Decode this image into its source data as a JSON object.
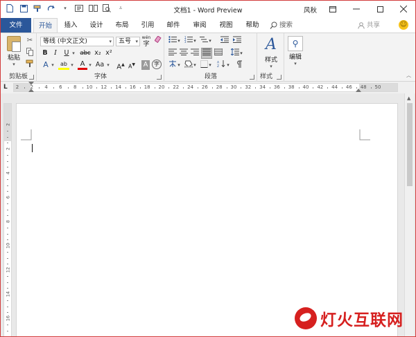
{
  "window": {
    "title": "文档1 - Word Preview",
    "user": "风秋",
    "controls": [
      "restore-icon",
      "minimize-icon",
      "maximize-icon",
      "close-icon"
    ]
  },
  "qat": {
    "icons": [
      "new-doc-icon",
      "save-icon",
      "format-painter-icon",
      "redo-icon",
      "text-box-icon",
      "two-pages-icon",
      "print-preview-icon",
      "customize-icon"
    ]
  },
  "tabs": [
    {
      "label": "文件"
    },
    {
      "label": "开始"
    },
    {
      "label": "插入"
    },
    {
      "label": "设计"
    },
    {
      "label": "布局"
    },
    {
      "label": "引用"
    },
    {
      "label": "邮件"
    },
    {
      "label": "审阅"
    },
    {
      "label": "视图"
    },
    {
      "label": "帮助"
    }
  ],
  "search": {
    "label": "搜索"
  },
  "share": {
    "label": "共享"
  },
  "ribbon": {
    "clipboard": {
      "paste_label": "粘贴",
      "group_label": "剪贴板"
    },
    "font": {
      "font_name": "等线 (中文正文)",
      "font_size": "五号",
      "phonetic": "wén",
      "bold": "B",
      "italic": "I",
      "underline": "U",
      "strike": "abc",
      "subscript": "x₂",
      "superscript": "x²",
      "font_color_glyph": "A",
      "highlight_glyph": "ab",
      "change_case": "Aa",
      "grow": "A",
      "shrink": "A",
      "char_border": "A",
      "enclose": "字",
      "group_label": "字体"
    },
    "paragraph": {
      "group_label": "段落"
    },
    "styles": {
      "label": "样式",
      "group_label": "样式"
    },
    "editing": {
      "label": "编辑"
    }
  },
  "ruler": {
    "corner": "L",
    "ticks": [
      "2",
      "2",
      "4",
      "6",
      "8",
      "10",
      "12",
      "14",
      "16",
      "18",
      "20",
      "22",
      "24",
      "26",
      "28",
      "30",
      "32",
      "34",
      "36",
      "38",
      "40",
      "42",
      "44",
      "46",
      "48",
      "50"
    ],
    "vticks": [
      "2",
      "2",
      "4",
      "6",
      "8",
      "10",
      "12",
      "14",
      "16"
    ]
  },
  "watermark": {
    "text": "灯火互联网"
  },
  "colors": {
    "accent": "#2b579a",
    "frame": "#d23b3b",
    "watermark": "#d6201f"
  }
}
